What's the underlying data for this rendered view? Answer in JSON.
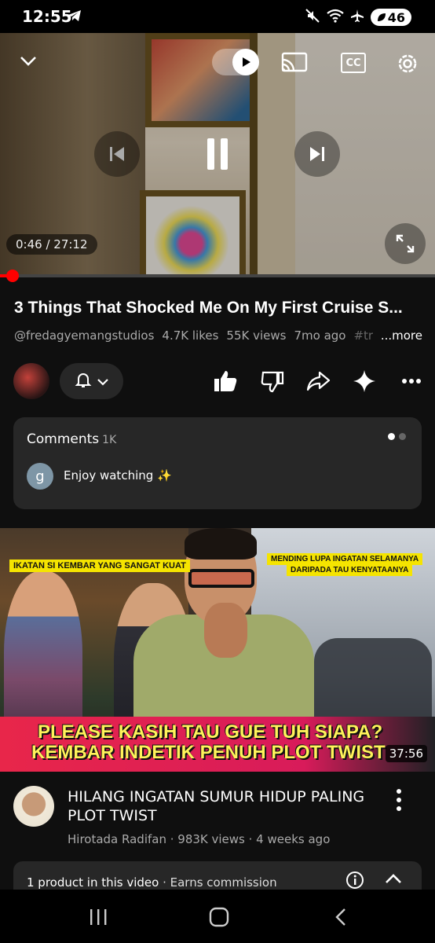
{
  "status_bar": {
    "time": "12:55",
    "battery": "46"
  },
  "player": {
    "current_time": "0:46 / 27:12",
    "progress_fraction": 0.028,
    "icons": [
      "chevron-down-icon",
      "autoplay-toggle-icon",
      "cast-icon",
      "captions-icon",
      "settings-icon",
      "previous-icon",
      "pause-icon",
      "next-icon",
      "fullscreen-icon"
    ],
    "captions_label": "CC"
  },
  "video": {
    "title": "3 Things That Shocked Me On My First Cruise S...",
    "channel": "@fredagyemangstudios",
    "likes": "4.7K likes",
    "views": "55K views",
    "age": "7mo ago",
    "hashtag": "#travelg",
    "more": "...more"
  },
  "comments": {
    "heading": "Comments",
    "count": "1K",
    "avatar_letter": "g",
    "text": "Enjoy watching ✨"
  },
  "next_video": {
    "caption_left": "IKATAN SI KEMBAR YANG SANGAT KUAT",
    "caption_right_1": "MENDING LUPA INGATAN SELAMANYA",
    "caption_right_2": "DARIPADA TAU KENYATAANYA",
    "banner_line_1": "PLEASE KASIH TAU GUE TUH SIAPA?",
    "banner_line_2": "KEMBAR INDETIK PENUH PLOT TWIST",
    "duration": "37:56",
    "title": "HILANG INGATAN SUMUR HIDUP PALING PLOT TWIST",
    "meta": "Hirotada Radifan · 983K views · 4 weeks ago"
  },
  "product_strip": {
    "label": "1 product in this video",
    "sub": " · Earns commission"
  },
  "colors": {
    "background": "#0f0f0f",
    "card": "#272727",
    "accent": "#ff0000",
    "banner": "#e8264a",
    "banner_text": "#fff25a"
  }
}
